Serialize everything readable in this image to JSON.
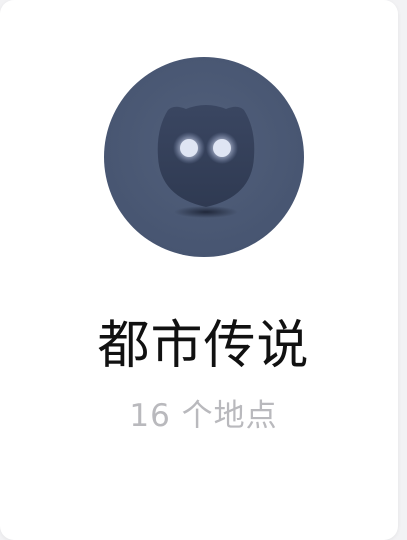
{
  "card": {
    "icon": "owl-ghost-icon",
    "title": "都市传说",
    "count": "16",
    "count_suffix": "个地点"
  },
  "colors": {
    "icon_bg": "#4d5a74",
    "title": "#111111",
    "subtitle": "#b9b9bd"
  }
}
